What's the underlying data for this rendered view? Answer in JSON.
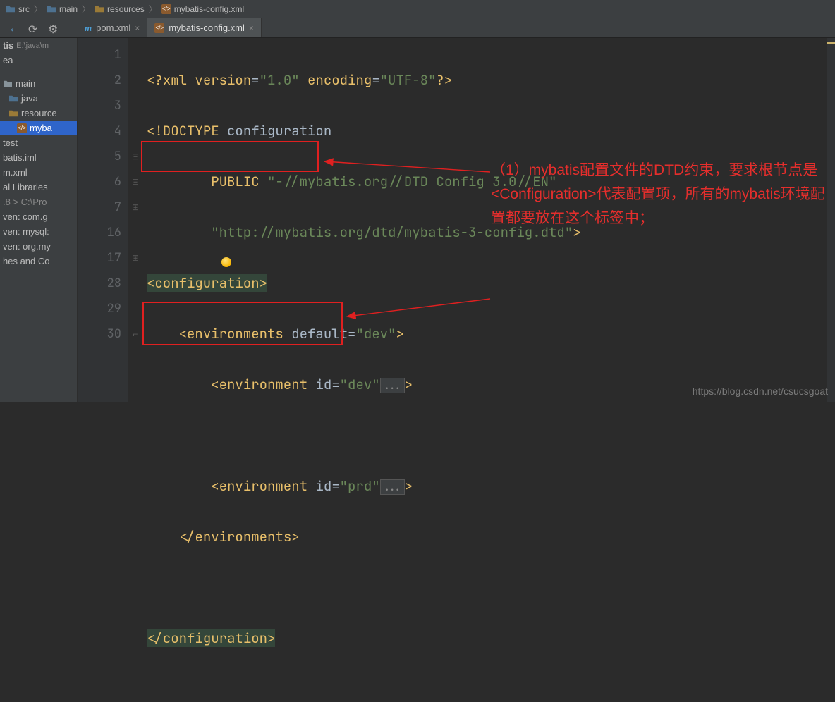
{
  "breadcrumb": {
    "items": [
      "src",
      "main",
      "resources",
      "mybatis-config.xml"
    ]
  },
  "tabs": [
    {
      "label": "pom.xml",
      "icon": "m-icon"
    },
    {
      "label": "mybatis-config.xml",
      "icon": "xml-icon",
      "active": true
    }
  ],
  "sidebar": {
    "header1": "tis",
    "header1_path": "E:\\java\\m",
    "header2": "ea",
    "items": [
      "main",
      "java",
      "resource",
      "myba",
      "test",
      "batis.iml",
      "m.xml",
      "al Libraries",
      ".8 >  C:\\Pro",
      "ven: com.g",
      "ven: mysql:",
      "ven: org.my",
      "hes and Co"
    ]
  },
  "gutter": [
    "1",
    "2",
    "3",
    "4",
    "5",
    "6",
    "7",
    "16",
    "17",
    "28",
    "29",
    "30"
  ],
  "code": {
    "l1_pre": "<?",
    "l1_tag": "xml version",
    "l1_eq": "=",
    "l1_v1": "\"1.0\"",
    "l1_enc": " encoding",
    "l1_v2": "\"UTF-8\"",
    "l1_post": "?>",
    "l2_pre": "<!",
    "l2_kw": "DOCTYPE ",
    "l2_name": "configuration",
    "l3_kw": "PUBLIC ",
    "l3_v": "\"-//mybatis.org//DTD Config 3.0//EN\"",
    "l4_v": "\"http://mybatis.org/dtd/mybatis-3-config.dtd\"",
    "l4_gt": ">",
    "l5_open": "<",
    "l5_tag": "configuration",
    "l5_close": ">",
    "l6_open": "<",
    "l6_tag": "environments ",
    "l6_attr": "default",
    "l6_eq": "=",
    "l6_val": "\"dev\"",
    "l6_close": ">",
    "l7_open": "<",
    "l7_tag": "environment ",
    "l7_attr": "id",
    "l7_val": "\"dev\"",
    "fold": "...",
    "l7_close": ">",
    "l8_open": "<",
    "l8_tag": "environment ",
    "l8_attr": "id",
    "l8_val": "\"prd\"",
    "l8_close": ">",
    "l9_open": "</",
    "l9_tag": "environments",
    "l9_close": ">",
    "l11_open": "</",
    "l11_tag": "configuration",
    "l11_close": ">"
  },
  "annotation": {
    "text": "（1）mybatis配置文件的DTD约束，要求根节点是<Configuration>代表配置项，所有的mybatis环境配置都要放在这个标签中；"
  },
  "watermark": "https://blog.csdn.net/csucsgoat"
}
